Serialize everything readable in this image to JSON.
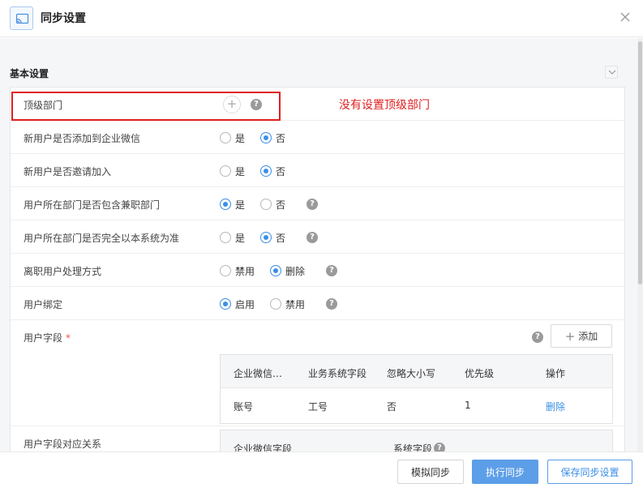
{
  "header": {
    "icon": "cast-icon",
    "title": "同步设置"
  },
  "section": {
    "title": "基本设置"
  },
  "annotation": {
    "text": "没有设置顶级部门",
    "color": "#e02020"
  },
  "rows": {
    "top_dept": {
      "label": "顶级部门"
    },
    "add_user": {
      "label": "新用户是否添加到企业微信",
      "options": [
        "是",
        "否"
      ],
      "selected": "否"
    },
    "invite_user": {
      "label": "新用户是否邀请加入",
      "options": [
        "是",
        "否"
      ],
      "selected": "否"
    },
    "include_part_time": {
      "label": "用户所在部门是否包含兼职部门",
      "options": [
        "是",
        "否"
      ],
      "selected": "是"
    },
    "dept_source": {
      "label": "用户所在部门是否完全以本系统为准",
      "options": [
        "是",
        "否"
      ],
      "selected": "否"
    },
    "resigned": {
      "label": "离职用户处理方式",
      "options": [
        "禁用",
        "删除"
      ],
      "selected": "删除"
    },
    "binding": {
      "label": "用户绑定",
      "options": [
        "启用",
        "禁用"
      ],
      "selected": "启用"
    },
    "user_fields": {
      "label": "用户字段",
      "required_mark": "*",
      "add_label": "添加"
    },
    "field_mapping": {
      "label": "用户字段对应关系"
    }
  },
  "fields_table": {
    "headers": [
      "企业微信…",
      "业务系统字段",
      "忽略大小写",
      "优先级",
      "操作"
    ],
    "rows": [
      {
        "wechat_field": "账号",
        "system_field": "工号",
        "ignore_case": "否",
        "priority": "1",
        "action": "删除"
      }
    ]
  },
  "mapping_table": {
    "headers": [
      "企业微信字段",
      "系统字段"
    ]
  },
  "footer": {
    "simulate_label": "模拟同步",
    "execute_label": "执行同步",
    "save_label": "保存同步设置"
  },
  "colors": {
    "accent": "#3a8ee6",
    "primary_button": "#5c9ee8",
    "required": "#f5554a"
  }
}
